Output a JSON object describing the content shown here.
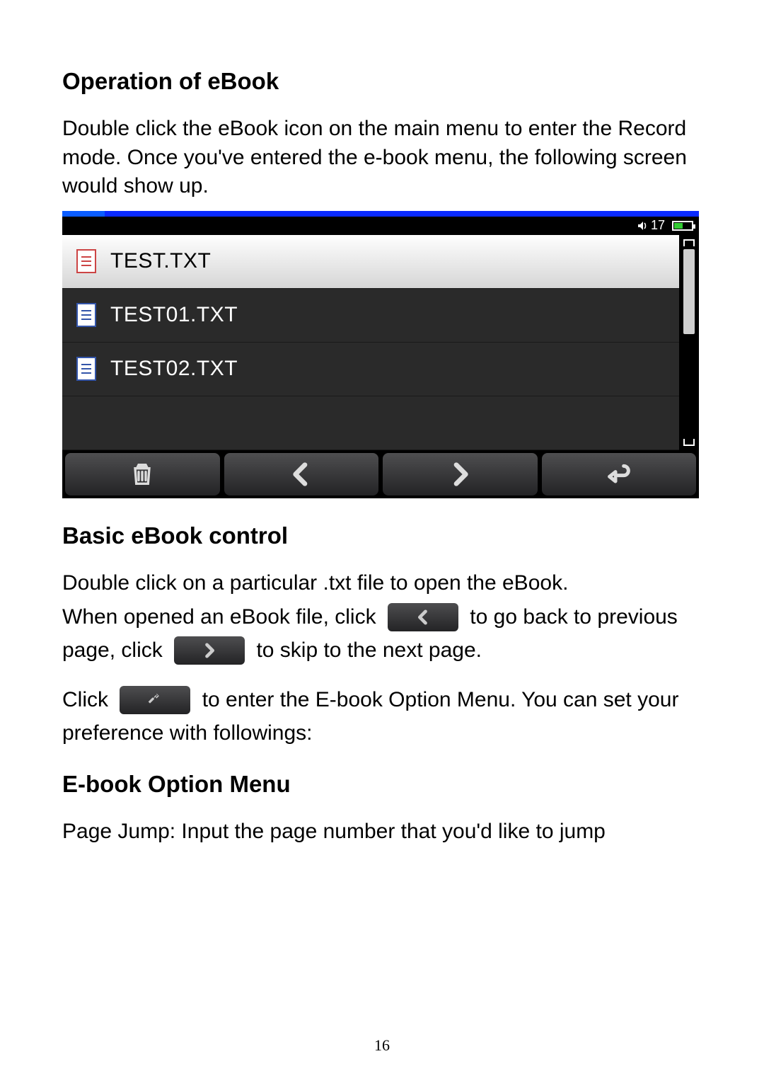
{
  "page_number": "16",
  "section1": {
    "title": "Operation of eBook",
    "para": "Double click the eBook icon on the main menu to enter the Record mode. Once you've entered the e-book menu, the following screen would show up."
  },
  "screenshot": {
    "volume_level": "17",
    "files": [
      {
        "name": "TEST.TXT",
        "selected": true
      },
      {
        "name": "TEST01.TXT",
        "selected": false
      },
      {
        "name": "TEST02.TXT",
        "selected": false
      }
    ],
    "toolbar": {
      "delete_label": "delete",
      "prev_label": "previous",
      "next_label": "next",
      "return_label": "return"
    }
  },
  "section2": {
    "title": "Basic eBook control",
    "line1_a": "Double click on a particular .txt file to open the eBook.",
    "line2_a": "When opened an eBook file, click",
    "line2_b": "to go back to previous page, click",
    "line2_c": "to skip to the next page.",
    "line3_a": "Click",
    "line3_b": "to enter the E-book Option Menu. You can set your preference with followings:"
  },
  "section3": {
    "title": "E-book Option Menu",
    "para": "Page Jump: Input the page number that you'd like to jump"
  }
}
